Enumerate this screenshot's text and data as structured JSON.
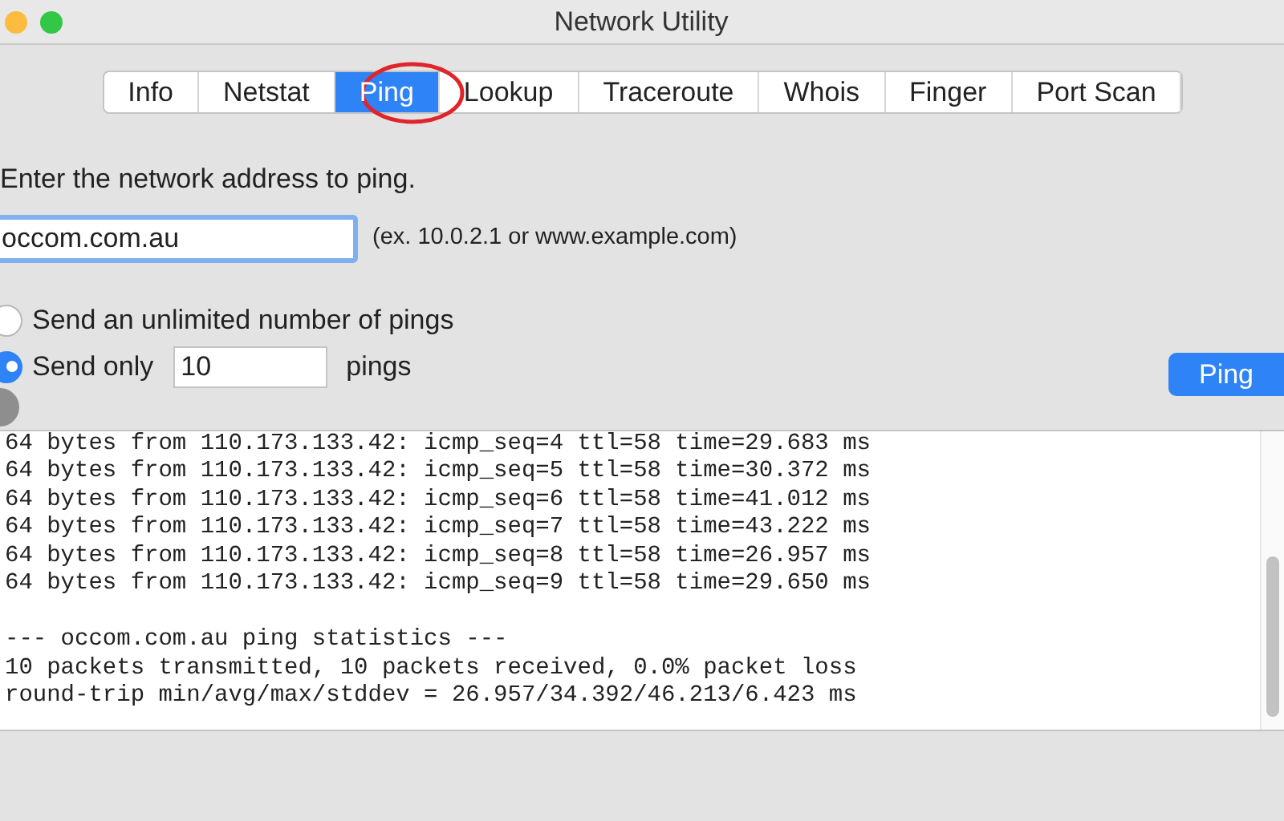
{
  "window": {
    "title": "Network Utility"
  },
  "tabs": [
    {
      "label": "Info",
      "selected": false
    },
    {
      "label": "Netstat",
      "selected": false
    },
    {
      "label": "Ping",
      "selected": true
    },
    {
      "label": "Lookup",
      "selected": false
    },
    {
      "label": "Traceroute",
      "selected": false
    },
    {
      "label": "Whois",
      "selected": false
    },
    {
      "label": "Finger",
      "selected": false
    },
    {
      "label": "Port Scan",
      "selected": false
    }
  ],
  "address": {
    "label": "Enter the network address to ping.",
    "value": "occom.com.au",
    "hint": "(ex. 10.0.2.1 or www.example.com)"
  },
  "options": [
    {
      "kind": "plain",
      "label": "Send an unlimited number of pings",
      "selected": false
    },
    {
      "kind": "count",
      "label": "Send only",
      "value": "10",
      "suffix": "pings",
      "selected": true
    }
  ],
  "ping_button": "Ping",
  "output": [
    "64 bytes from 110.173.133.42: icmp_seq=4 ttl=58 time=29.683 ms",
    "64 bytes from 110.173.133.42: icmp_seq=5 ttl=58 time=30.372 ms",
    "64 bytes from 110.173.133.42: icmp_seq=6 ttl=58 time=41.012 ms",
    "64 bytes from 110.173.133.42: icmp_seq=7 ttl=58 time=43.222 ms",
    "64 bytes from 110.173.133.42: icmp_seq=8 ttl=58 time=26.957 ms",
    "64 bytes from 110.173.133.42: icmp_seq=9 ttl=58 time=29.650 ms",
    "--- occom.com.au ping statistics ---",
    "10 packets transmitted, 10 packets received, 0.0% packet loss",
    "round-trip min/avg/max/stddev = 26.957/34.392/46.213/6.423 ms"
  ]
}
